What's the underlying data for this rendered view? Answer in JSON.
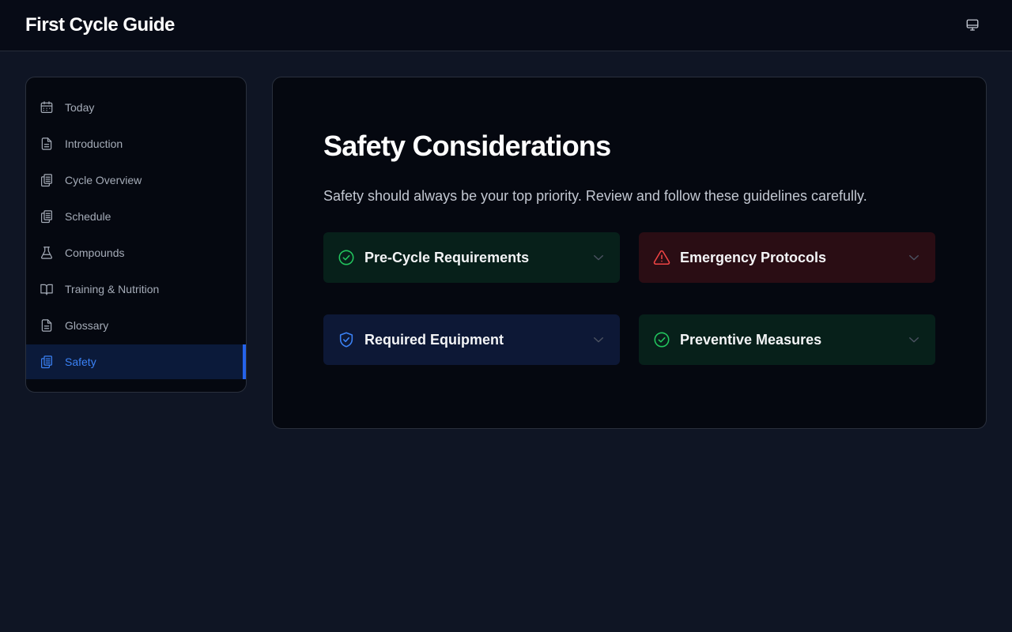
{
  "app": {
    "title": "First Cycle Guide"
  },
  "header": {
    "theme_icon": "monitor-icon"
  },
  "sidebar": {
    "items": [
      {
        "label": "Today",
        "icon": "calendar-icon"
      },
      {
        "label": "Introduction",
        "icon": "document-icon"
      },
      {
        "label": "Cycle Overview",
        "icon": "clipboard-icon"
      },
      {
        "label": "Schedule",
        "icon": "clipboard-icon"
      },
      {
        "label": "Compounds",
        "icon": "flask-icon"
      },
      {
        "label": "Training & Nutrition",
        "icon": "book-icon"
      },
      {
        "label": "Glossary",
        "icon": "document-icon"
      },
      {
        "label": "Safety",
        "icon": "clipboard-icon",
        "active": true
      }
    ]
  },
  "main": {
    "title": "Safety Considerations",
    "description": "Safety should always be your top priority. Review and follow these guidelines carefully.",
    "cards": [
      {
        "label": "Pre-Cycle Requirements",
        "icon": "check-circle-icon",
        "color": "#22c55e"
      },
      {
        "label": "Emergency Protocols",
        "icon": "warning-triangle-icon",
        "color": "#ef4444"
      },
      {
        "label": "Required Equipment",
        "icon": "shield-check-icon",
        "color": "#3b82f6"
      },
      {
        "label": "Preventive Measures",
        "icon": "check-circle-icon",
        "color": "#22c55e"
      }
    ]
  },
  "colors": {
    "accent": "#2563eb",
    "success": "#22c55e",
    "danger": "#ef4444"
  }
}
